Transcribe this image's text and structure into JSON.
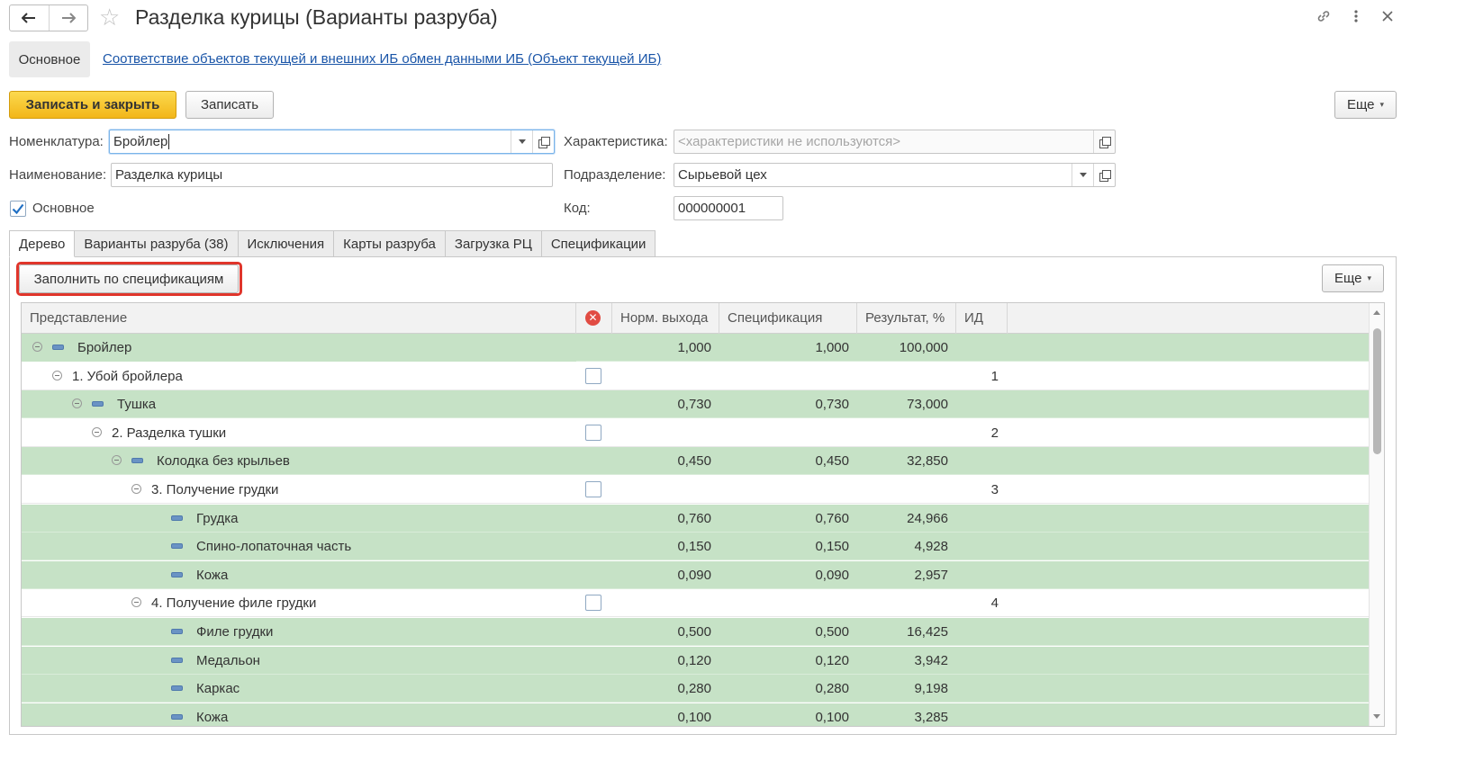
{
  "window": {
    "title": "Разделка курицы (Варианты разруба)"
  },
  "sections": {
    "active": "Основное",
    "link": "Соответствие объектов текущей и внешних ИБ обмен данными ИБ (Объект текущей ИБ)"
  },
  "toolbar": {
    "save_close": "Записать и закрыть",
    "save": "Записать",
    "more": "Еще"
  },
  "form": {
    "nomenclature_label": "Номенклатура:",
    "nomenclature_value": "Бройлер",
    "name_label": "Наименование:",
    "name_value": "Разделка курицы",
    "main_label": "Основное",
    "main_checked": true,
    "characteristic_label": "Характеристика:",
    "characteristic_placeholder": "<характеристики не используются>",
    "division_label": "Подразделение:",
    "division_value": "Сырьевой цех",
    "code_label": "Код:",
    "code_value": "000000001"
  },
  "tabs": [
    "Дерево",
    "Варианты разруба (38)",
    "Исключения",
    "Карты разруба",
    "Загрузка РЦ",
    "Спецификации"
  ],
  "active_tab": "Дерево",
  "tree_panel": {
    "fill_button": "Заполнить по спецификациям",
    "more": "Еще"
  },
  "table": {
    "columns": {
      "representation": "Представление",
      "norm": "Норм. выхода",
      "spec": "Спецификация",
      "result": "Результат, %",
      "id": "ИД"
    },
    "rows": [
      {
        "kind": "product",
        "level": 0,
        "label": "Бройлер",
        "expanded": true,
        "norm": "1,000",
        "spec": "1,000",
        "result": "100,000",
        "id": ""
      },
      {
        "kind": "operation",
        "level": 1,
        "label": "1. Убой бройлера",
        "expanded": true,
        "checked": false,
        "norm": "",
        "spec": "",
        "result": "",
        "id": "1"
      },
      {
        "kind": "product",
        "level": 2,
        "label": "Тушка",
        "expanded": true,
        "norm": "0,730",
        "spec": "0,730",
        "result": "73,000",
        "id": ""
      },
      {
        "kind": "operation",
        "level": 3,
        "label": "2. Разделка тушки",
        "expanded": true,
        "checked": false,
        "norm": "",
        "spec": "",
        "result": "",
        "id": "2"
      },
      {
        "kind": "product",
        "level": 4,
        "label": "Колодка без крыльев",
        "expanded": true,
        "norm": "0,450",
        "spec": "0,450",
        "result": "32,850",
        "id": ""
      },
      {
        "kind": "operation",
        "level": 5,
        "label": "3. Получение грудки",
        "expanded": true,
        "checked": false,
        "norm": "",
        "spec": "",
        "result": "",
        "id": "3"
      },
      {
        "kind": "product",
        "level": 6,
        "label": "Грудка",
        "expanded": false,
        "norm": "0,760",
        "spec": "0,760",
        "result": "24,966",
        "id": ""
      },
      {
        "kind": "product",
        "level": 6,
        "label": "Спино-лопаточная часть",
        "expanded": false,
        "norm": "0,150",
        "spec": "0,150",
        "result": "4,928",
        "id": ""
      },
      {
        "kind": "product",
        "level": 6,
        "label": "Кожа",
        "expanded": false,
        "norm": "0,090",
        "spec": "0,090",
        "result": "2,957",
        "id": ""
      },
      {
        "kind": "operation",
        "level": 5,
        "label": "4. Получение филе грудки",
        "expanded": true,
        "checked": false,
        "norm": "",
        "spec": "",
        "result": "",
        "id": "4"
      },
      {
        "kind": "product",
        "level": 6,
        "label": "Филе грудки",
        "expanded": false,
        "norm": "0,500",
        "spec": "0,500",
        "result": "16,425",
        "id": ""
      },
      {
        "kind": "product",
        "level": 6,
        "label": "Медальон",
        "expanded": false,
        "norm": "0,120",
        "spec": "0,120",
        "result": "3,942",
        "id": ""
      },
      {
        "kind": "product",
        "level": 6,
        "label": "Каркас",
        "expanded": false,
        "norm": "0,280",
        "spec": "0,280",
        "result": "9,198",
        "id": ""
      },
      {
        "kind": "product",
        "level": 6,
        "label": "Кожа",
        "expanded": false,
        "norm": "0,100",
        "spec": "0,100",
        "result": "3,285",
        "id": ""
      }
    ]
  },
  "colors": {
    "accent": "#f2b619",
    "product_row": "#c6e2c6",
    "highlight_frame": "#e0352b",
    "link": "#1a55a8"
  },
  "icons": {
    "back": "arrow-left-icon",
    "forward": "arrow-right-icon",
    "favorite": "star-icon",
    "link": "link-icon",
    "menu": "kebab-menu-icon",
    "close": "close-icon",
    "error_column": "error-circle-icon",
    "leaf": "product-leaf-icon",
    "toggle": "tree-collapse-icon"
  }
}
